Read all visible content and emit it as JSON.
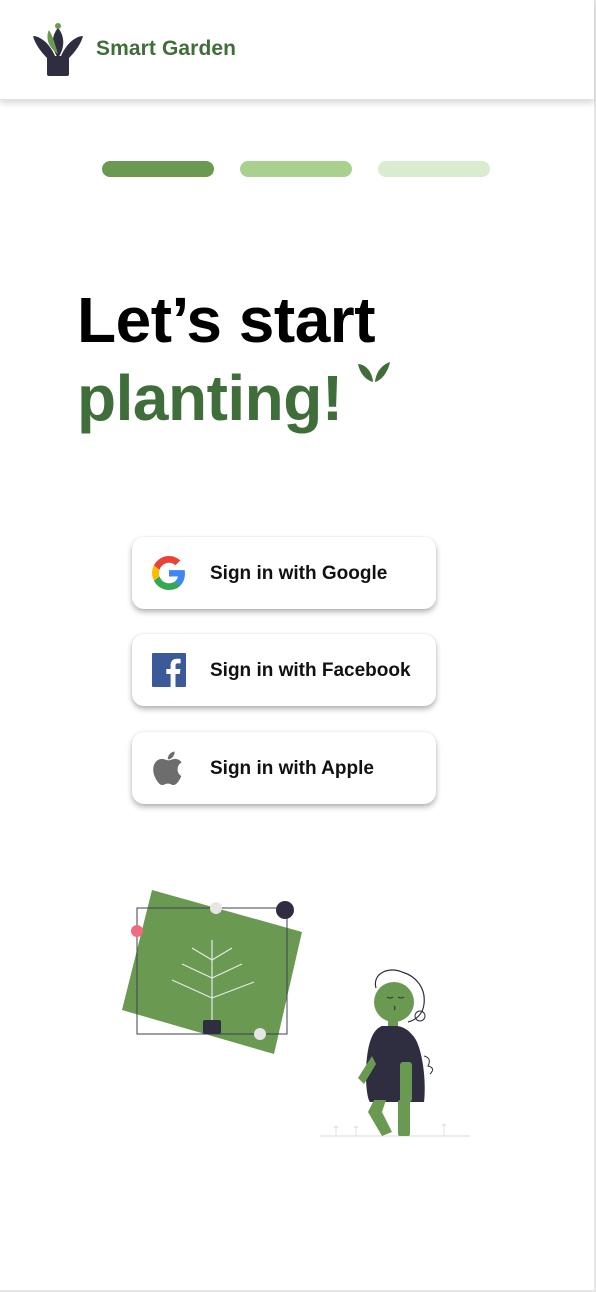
{
  "header": {
    "brand": "Smart Garden",
    "logo_icon": "potted-plant-icon"
  },
  "progress": {
    "current_step": 1,
    "total_steps": 3,
    "colors": [
      "#6a9a52",
      "#a9d08e",
      "#d9ecd0"
    ]
  },
  "headline": {
    "line1": "Let’s start",
    "line2": "planting!",
    "accent_icon": "sprout-icon"
  },
  "auth": {
    "google": {
      "label": "Sign in with Google",
      "icon": "google-icon"
    },
    "facebook": {
      "label": "Sign in with Facebook",
      "icon": "facebook-icon"
    },
    "apple": {
      "label": "Sign in with Apple",
      "icon": "apple-icon"
    }
  },
  "illustration": {
    "name": "person-with-plant-frame-illustration"
  },
  "colors": {
    "brand_green": "#3f6e3a",
    "illustration_green": "#6a9a52",
    "dark_navy": "#2f2e41",
    "facebook_blue": "#3c5a99",
    "apple_gray": "#6d6d6d"
  }
}
